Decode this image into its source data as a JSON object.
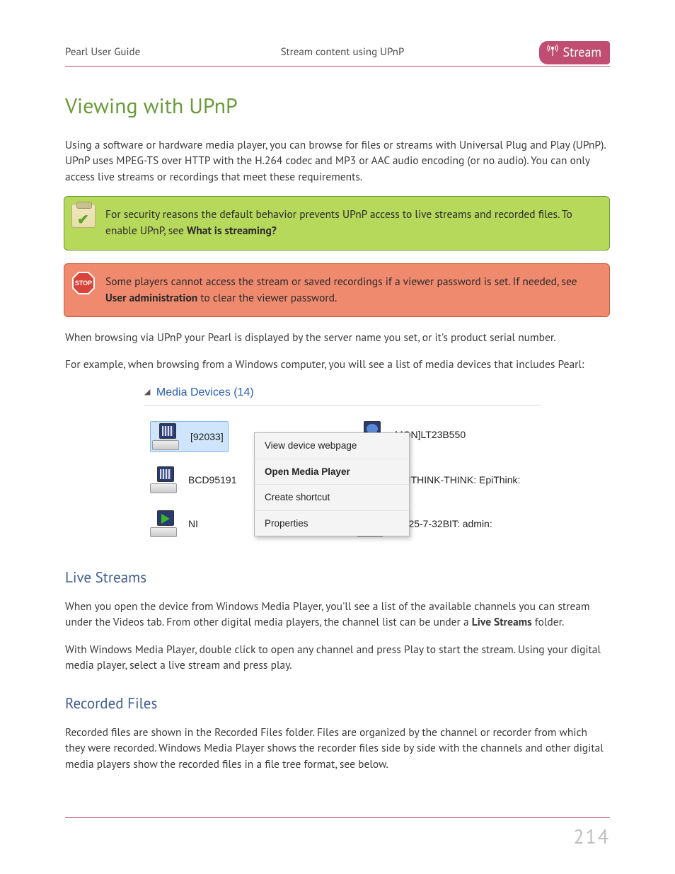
{
  "header": {
    "left": "Pearl User Guide",
    "center": "Stream content using UPnP",
    "pill": "Stream"
  },
  "title": "Viewing with UPnP",
  "intro": "Using a software or hardware media player, you can browse for files or streams with Universal Plug and Play (UPnP). UPnP uses MPEG-TS over HTTP with the H.264 codec and MP3 or AAC audio encoding (or no audio). You can only access live streams or recordings that meet these requirements.",
  "callouts": {
    "tip": {
      "pre": "For security reasons the default behavior prevents UPnP access to live streams and recorded files. To enable UPnP, see ",
      "link": "What is streaming?"
    },
    "stop": {
      "pre": "Some players cannot access the stream or saved recordings if a viewer password is set. If needed, see ",
      "link": "User administration",
      "post": " to clear the viewer password."
    }
  },
  "after_callouts": [
    "When browsing via UPnP your Pearl is displayed by the server name you set, or it's product serial number.",
    "For example, when browsing from a Windows computer, you will see a list of media devices that includes Pearl:"
  ],
  "figure": {
    "heading": "Media Devices (14)",
    "devices": {
      "a": "[92033]",
      "b": "BCD95191",
      "c": "NI",
      "d": "MON]LT23B550",
      "e": "EPITHINK-THINK: EpiThink:",
      "f": "PC25-7-32BIT: admin:"
    },
    "menu": {
      "m1": "View device webpage",
      "m2": "Open Media Player",
      "m3": "Create shortcut",
      "m4": "Properties"
    }
  },
  "sections": {
    "live": {
      "heading": "Live Streams",
      "p1_pre": "When you open the device from Windows Media Player, you'll see a list of the available channels you can stream under the Videos tab.  From other digital media players, the channel list can be under a ",
      "p1_bold": "Live Streams",
      "p1_post": " folder.",
      "p2": "With Windows Media Player, double click to open any channel and press Play to start the stream. Using your digital media player, select a live stream and press play."
    },
    "rec": {
      "heading": "Recorded Files",
      "p1": "Recorded files are shown in the Recorded Files folder. Files are organized by the channel or recorder from which they were recorded. Windows Media Player shows the recorder files side by side with the channels and other digital media players show the recorded files in a file tree format, see below."
    }
  },
  "page_number": "214"
}
